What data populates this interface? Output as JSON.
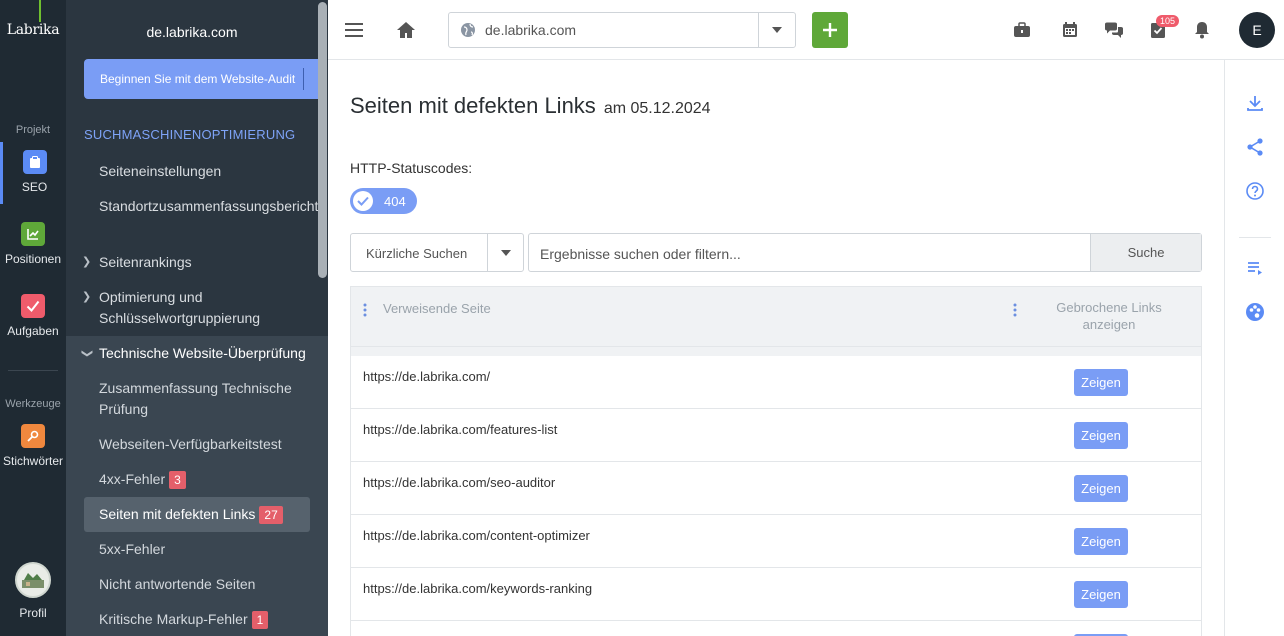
{
  "rail": {
    "logo": "Labrika",
    "group_project": "Projekt",
    "group_tools": "Werkzeuge",
    "items": [
      {
        "label": "SEO",
        "icon": "clipboard-icon",
        "color": "#5b8bf5"
      },
      {
        "label": "Positionen",
        "icon": "chart-icon",
        "color": "#5fa839"
      },
      {
        "label": "Aufgaben",
        "icon": "check-icon",
        "color": "#ef5b6b"
      },
      {
        "label": "Stichwörter",
        "icon": "key-icon",
        "color": "#f0883e"
      }
    ],
    "profile_label": "Profil"
  },
  "sidebar": {
    "domain": "de.labrika.com",
    "audit_button": "Beginnen Sie mit dem Website-Audit",
    "section_title": "SUCHMASCHINENOPTIMIERUNG",
    "items": [
      {
        "label": "Seiteneinstellungen"
      },
      {
        "label": "Standortzusammenfassungsbericht"
      },
      {
        "label": "Seitenrankings"
      },
      {
        "label": "Optimierung und Schlüsselwortgruppierung"
      },
      {
        "label": "Technische Website-Überprüfung"
      }
    ],
    "sub_items": [
      {
        "label": "Zusammenfassung Technische Prüfung"
      },
      {
        "label": "Webseiten-Verfügbarkeitstest"
      },
      {
        "label": "4xx-Fehler",
        "badge": "3"
      },
      {
        "label": "Seiten mit defekten Links",
        "badge": "27"
      },
      {
        "label": "5xx-Fehler"
      },
      {
        "label": "Nicht antwortende Seiten"
      },
      {
        "label": "Kritische Markup-Fehler",
        "badge": "1"
      }
    ]
  },
  "topbar": {
    "url": "de.labrika.com",
    "notification_count": "105",
    "user_initial": "E"
  },
  "main": {
    "title": "Seiten mit defekten Links",
    "date": "am 05.12.2024",
    "status_label": "HTTP-Statuscodes:",
    "status_chip": "404",
    "recent_label": "Kürzliche Suchen",
    "search_placeholder": "Ergebnisse suchen oder filtern...",
    "search_button": "Suche",
    "table": {
      "col_page": "Verweisende Seite",
      "col_links": "Gebrochene Links anzeigen",
      "show_label": "Zeigen",
      "rows": [
        {
          "url": "https://de.labrika.com/"
        },
        {
          "url": "https://de.labrika.com/features-list"
        },
        {
          "url": "https://de.labrika.com/seo-auditor"
        },
        {
          "url": "https://de.labrika.com/content-optimizer"
        },
        {
          "url": "https://de.labrika.com/keywords-ranking"
        }
      ]
    }
  }
}
